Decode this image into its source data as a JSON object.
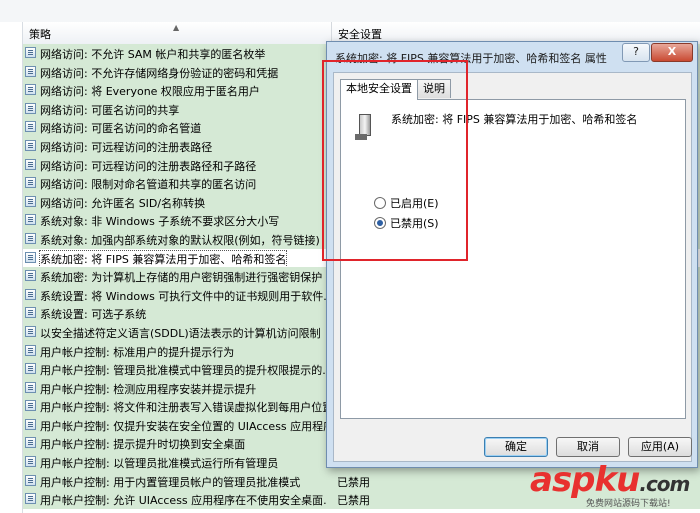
{
  "header": {
    "col_policy": "策略",
    "col_security": "安全设置"
  },
  "rows": [
    {
      "policy": "网络访问: 不允许 SAM 帐户和共享的匿名枚举",
      "setting": ""
    },
    {
      "policy": "网络访问: 不允许存储网络身份验证的密码和凭据",
      "setting": ""
    },
    {
      "policy": "网络访问: 将 Everyone 权限应用于匿名用户",
      "setting": ""
    },
    {
      "policy": "网络访问: 可匿名访问的共享",
      "setting": ""
    },
    {
      "policy": "网络访问: 可匿名访问的命名管道",
      "setting": ""
    },
    {
      "policy": "网络访问: 可远程访问的注册表路径",
      "setting": ""
    },
    {
      "policy": "网络访问: 可远程访问的注册表路径和子路径",
      "setting": ""
    },
    {
      "policy": "网络访问: 限制对命名管道和共享的匿名访问",
      "setting": ""
    },
    {
      "policy": "网络访问: 允许匿名 SID/名称转换",
      "setting": ""
    },
    {
      "policy": "系统对象: 非 Windows 子系统不要求区分大小写",
      "setting": ""
    },
    {
      "policy": "系统对象: 加强内部系统对象的默认权限(例如，符号链接)",
      "setting": ""
    },
    {
      "policy": "系统加密: 将 FIPS 兼容算法用于加密、哈希和签名",
      "setting": ""
    },
    {
      "policy": "系统加密: 为计算机上存储的用户密钥强制进行强密钥保护",
      "setting": ""
    },
    {
      "policy": "系统设置: 将 Windows 可执行文件中的证书规则用于软件...",
      "setting": ""
    },
    {
      "policy": "系统设置: 可选子系统",
      "setting": ""
    },
    {
      "policy": "以安全描述符定义语言(SDDL)语法表示的计算机访问限制",
      "setting": ""
    },
    {
      "policy": "用户帐户控制: 标准用户的提升提示行为",
      "setting": ""
    },
    {
      "policy": "用户帐户控制: 管理员批准模式中管理员的提升权限提示的...",
      "setting": ""
    },
    {
      "policy": "用户帐户控制: 检测应用程序安装并提示提升",
      "setting": ""
    },
    {
      "policy": "用户帐户控制: 将文件和注册表写入错误虚拟化到每用户位置",
      "setting": ""
    },
    {
      "policy": "用户帐户控制: 仅提升安装在安全位置的 UIAccess 应用程序",
      "setting": ""
    },
    {
      "policy": "用户帐户控制: 提示提升时切换到安全桌面",
      "setting": ""
    },
    {
      "policy": "用户帐户控制: 以管理员批准模式运行所有管理员",
      "setting": ""
    },
    {
      "policy": "用户帐户控制: 用于内置管理员帐户的管理员批准模式",
      "setting": "已禁用"
    },
    {
      "policy": "用户帐户控制: 允许 UIAccess 应用程序在不使用安全桌面...",
      "setting": "已禁用"
    }
  ],
  "dialog": {
    "title": "系统加密: 将 FIPS 兼容算法用于加密、哈希和签名 属性",
    "help_btn": "?",
    "close_btn": "X",
    "tabs": [
      "本地安全设置",
      "说明"
    ],
    "policy_name": "系统加密: 将 FIPS 兼容算法用于加密、哈希和签名",
    "option_enabled": "已启用(E)",
    "option_disabled": "已禁用(S)",
    "selected_option": "disabled",
    "btn_ok": "确定",
    "btn_cancel": "取消",
    "btn_apply": "应用(A)"
  },
  "watermark": {
    "brand": "aspku",
    "suffix": ".com",
    "sub": "免费网站源码下载站!"
  },
  "colors": {
    "row_bg": "#d5e9d5",
    "dialog_frame": "#cfe0f1",
    "highlight": "#e0242b",
    "watermark": "#e8312f"
  }
}
